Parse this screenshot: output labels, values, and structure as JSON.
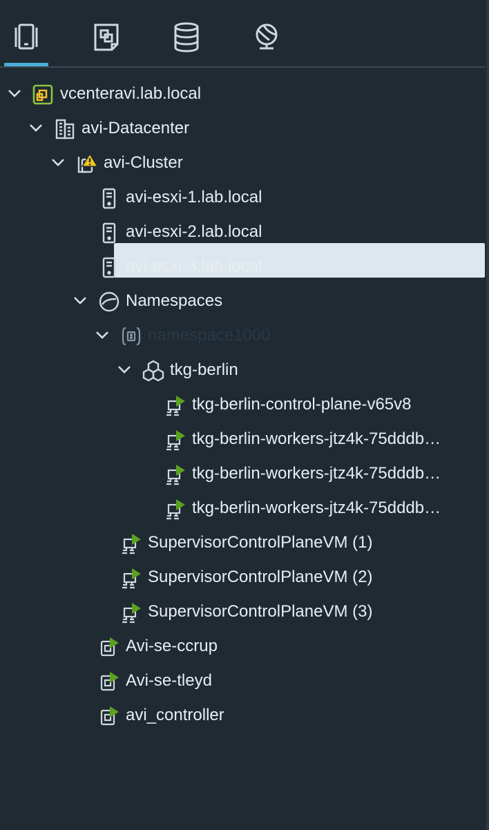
{
  "tabs": [
    {
      "name": "hosts-and-clusters",
      "icon": "hosts-clusters-icon",
      "active": true
    },
    {
      "name": "vms-and-templates",
      "icon": "vms-templates-icon",
      "active": false
    },
    {
      "name": "storage",
      "icon": "database-icon",
      "active": false
    },
    {
      "name": "networking",
      "icon": "network-globe-icon",
      "active": false
    }
  ],
  "tree": {
    "vcenter": "vcenteravi.lab.local",
    "datacenter": "avi-Datacenter",
    "cluster": "avi-Cluster",
    "hosts": [
      "avi-esxi-1.lab.local",
      "avi-esxi-2.lab.local",
      "avi-esxi-3.lab.local"
    ],
    "namespaces": "Namespaces",
    "namespace": "namespace1000",
    "tkc": "tkg-berlin",
    "tkc_vms": [
      "tkg-berlin-control-plane-v65v8",
      "tkg-berlin-workers-jtz4k-75dddb…",
      "tkg-berlin-workers-jtz4k-75dddb…",
      "tkg-berlin-workers-jtz4k-75dddb…"
    ],
    "supervisor_vms": [
      "SupervisorControlPlaneVM (1)",
      "SupervisorControlPlaneVM (2)",
      "SupervisorControlPlaneVM (3)"
    ],
    "cluster_vms": [
      "Avi-se-ccrup",
      "Avi-se-tleyd",
      "avi_controller"
    ]
  },
  "colors": {
    "background": "#1f2a33",
    "accent": "#49afd9",
    "selected_bg": "#dde7ee",
    "vm_power_on": "#5aa220",
    "vcenter_icon": "#8cc63f",
    "warning": "#f5c518"
  }
}
